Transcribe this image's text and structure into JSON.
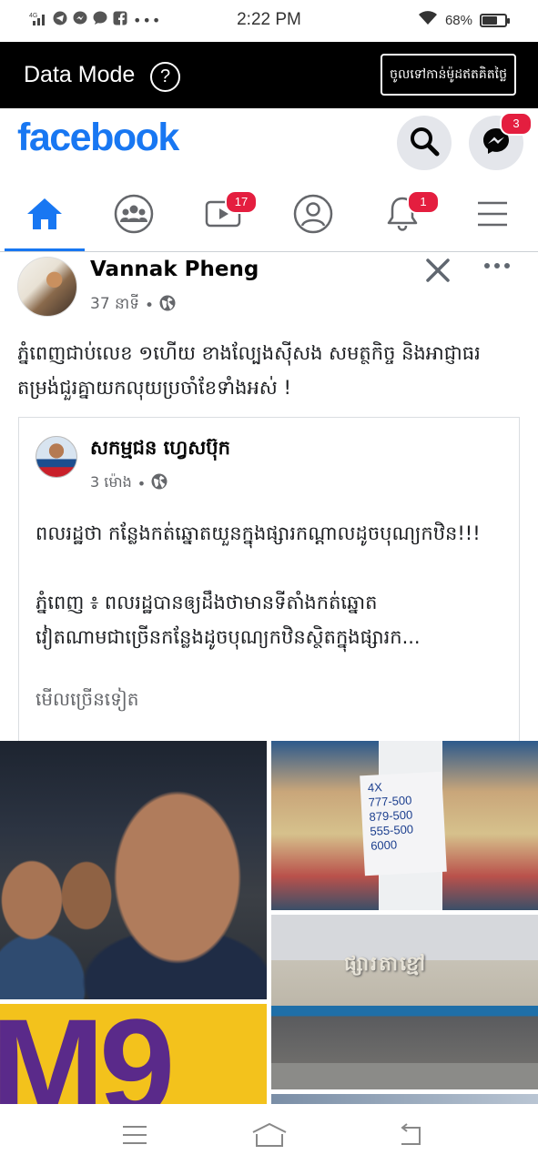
{
  "status_bar": {
    "network": "4G",
    "time": "2:22 PM",
    "battery": "68%",
    "battery_level": 0.68
  },
  "data_mode": {
    "label": "Data Mode",
    "help_icon": "?",
    "button": "ចូលទៅកាន់ម៉ូដឥតគិតថ្លៃ"
  },
  "header": {
    "logo": "facebook",
    "messenger_badge": "3"
  },
  "tabs": [
    {
      "name": "home",
      "icon": "home-icon",
      "active": true,
      "badge": ""
    },
    {
      "name": "groups",
      "icon": "groups-icon",
      "active": false,
      "badge": ""
    },
    {
      "name": "watch",
      "icon": "video-icon",
      "active": false,
      "badge": "17"
    },
    {
      "name": "profile",
      "icon": "profile-icon",
      "active": false,
      "badge": ""
    },
    {
      "name": "notifications",
      "icon": "bell-icon",
      "active": false,
      "badge": "1"
    },
    {
      "name": "menu",
      "icon": "menu-icon",
      "active": false,
      "badge": ""
    }
  ],
  "post": {
    "author": "Vannak Pheng",
    "time": "37 នាទី",
    "separator": "•",
    "text": "ភ្នំពេញជាប់លេខ ១ហើយ ខាងល្បែងស៊ីសង សមត្ថកិច្ច និងអាជ្ញាធរ តម្រង់ជួរគ្នាយកលុយប្រចាំខែទាំងអស់ !",
    "shared": {
      "author": "សកម្មជន ហ្វេសប៊ុក",
      "time": "3 ម៉ោង",
      "separator": "•",
      "para1": "ពលរដ្ឋថា កន្លែងកត់ឆ្នោតយួនក្នុងផ្សារកណ្តាលដូចបុណ្យកឋិន!!!",
      "para2_line1": "ភ្នំពេញ ៖ ពលរដ្ឋបានឲ្យដឹងថាមានទីតាំងកត់ឆ្នោត",
      "para2_line2": "វៀតណាមជាច្រើនកន្លែងដូចបុណ្យកឋិនស្ថិតក្នុងផ្សារក...",
      "see_more": "មើលច្រើនទៀត"
    },
    "photos": {
      "note_lines": [
        "4X",
        "777-500",
        "879-500",
        "555-500",
        "6000"
      ],
      "sign_text": "ផ្សារតាខ្មៅ",
      "banner_text": "M9"
    }
  },
  "colors": {
    "brand": "#1877f2",
    "badge": "#e41e3f",
    "data_bar": "#000000"
  }
}
